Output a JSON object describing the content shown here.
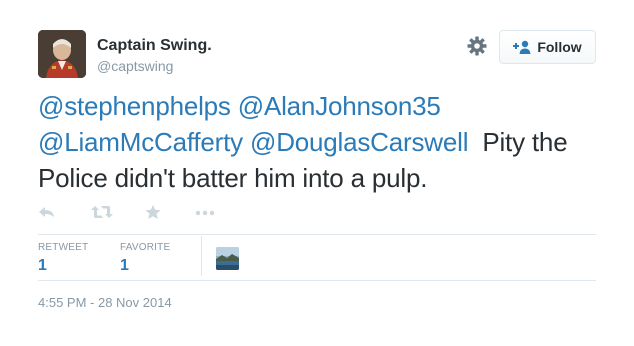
{
  "user": {
    "display_name": "Captain Swing.",
    "handle": "@captswing"
  },
  "follow_button": {
    "label": "Follow"
  },
  "tweet": {
    "mentions": [
      "@stephenphelps",
      "@AlanJohnson35",
      "@LiamMcCafferty",
      "@DouglasCarswell"
    ],
    "text": "Pity the Police didn't batter him into a pulp."
  },
  "actions": {
    "icons": [
      "reply-icon",
      "retweet-icon",
      "favorite-icon",
      "more-icon"
    ]
  },
  "stats": {
    "retweets_label": "RETWEET",
    "retweets_count": "1",
    "favorites_label": "FAVORITE",
    "favorites_count": "1"
  },
  "timestamp": "4:55 PM - 28 Nov 2014",
  "colors": {
    "link": "#2b7bb9",
    "muted": "#8899a6",
    "text": "#292f33",
    "border": "#e1e8ed"
  }
}
